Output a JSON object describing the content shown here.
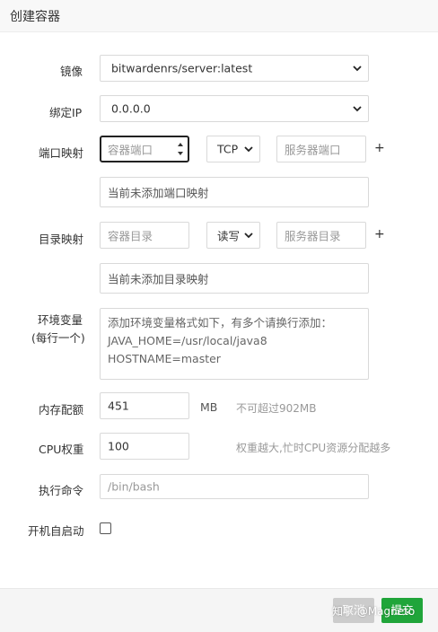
{
  "dialog": {
    "title": "创建容器"
  },
  "form": {
    "image": {
      "label": "镜像",
      "value": "bitwardenrs/server:latest"
    },
    "bind_ip": {
      "label": "绑定IP",
      "value": "0.0.0.0"
    },
    "port_mapping": {
      "label": "端口映射",
      "container_port_placeholder": "容器端口",
      "protocol": "TCP",
      "server_port_placeholder": "服务器端口",
      "add_symbol": "+",
      "empty_text": "当前未添加端口映射"
    },
    "dir_mapping": {
      "label": "目录映射",
      "container_dir_placeholder": "容器目录",
      "mode": "读写",
      "server_dir_placeholder": "服务器目录",
      "add_symbol": "+",
      "empty_text": "当前未添加目录映射"
    },
    "env": {
      "label_line1": "环境变量",
      "label_line2": "(每行一个)",
      "placeholder_lines": [
        "添加环境变量格式如下，有多个请换行添加：",
        "JAVA_HOME=/usr/local/java8",
        "HOSTNAME=master"
      ]
    },
    "memory": {
      "label": "内存配额",
      "value": "451",
      "unit": "MB",
      "hint": "不可超过902MB"
    },
    "cpu": {
      "label": "CPU权重",
      "value": "100",
      "hint": "权重越大,忙时CPU资源分配越多"
    },
    "command": {
      "label": "执行命令",
      "placeholder": "/bin/bash"
    },
    "autostart": {
      "label": "开机自启动",
      "checked": false
    }
  },
  "footer": {
    "cancel_label": "取消",
    "submit_label": "提交",
    "watermark": "知乎 @Magneto"
  },
  "colors": {
    "submit_bg": "#20a53a",
    "cancel_bg": "#cccccc",
    "focus_border": "#222222"
  }
}
